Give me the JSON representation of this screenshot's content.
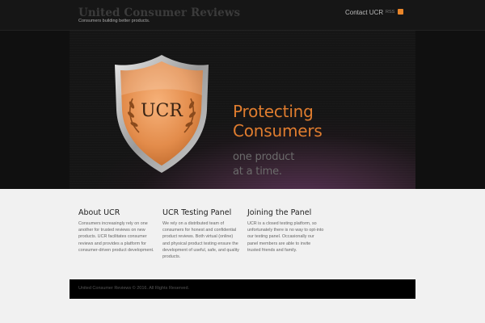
{
  "header": {
    "title": "United Consumer Reviews",
    "tagline": "Consumers building better products.",
    "nav_contact": "Contact UCR",
    "nav_rss": "RSS"
  },
  "hero": {
    "shield_text": "UCR",
    "heading_line1": "Protecting",
    "heading_line2": "Consumers",
    "sub_line1": "one product",
    "sub_line2": "at a time."
  },
  "sections": [
    {
      "title": "About UCR",
      "body": "Consumers increasingly rely on one another for trusted reviews on new products. UCR facilitates consumer reviews and provides a platform for consumer-driven product development."
    },
    {
      "title": "UCR Testing Panel",
      "body": "We rely on a distributed team of consumers for honest and confidential product reviews. Both virtual (online) and physical product testing ensure the development of useful, safe, and quality products."
    },
    {
      "title": "Joining the Panel",
      "body": "UCR is a closed testing platform, so unfortunately there is no way to opt-into our testing panel. Occasionally our panel members are able to invite trusted friends and family."
    }
  ],
  "footer": {
    "copyright": "United Consumer Reviews © 2016. All Rights Reserved."
  },
  "colors": {
    "accent": "#e07d2f",
    "rss": "#e9862a",
    "header_bg": "#161616",
    "body_bg": "#f1f1f1",
    "footer_bg": "#000000"
  },
  "icons": {
    "rss": "rss-icon",
    "logo": "shield-laurel-icon"
  }
}
